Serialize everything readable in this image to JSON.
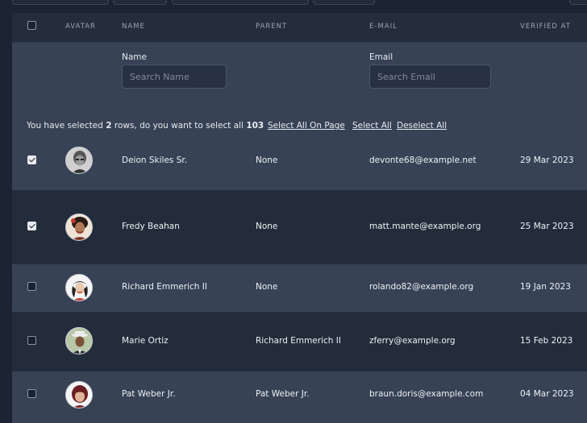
{
  "columns": {
    "avatar": "AVATAR",
    "name": "NAME",
    "parent": "PARENT",
    "email": "E-MAIL",
    "verified_at": "VERIFIED AT"
  },
  "filters": {
    "name_label": "Name",
    "name_placeholder": "Search Name",
    "email_label": "Email",
    "email_placeholder": "Search Email"
  },
  "selection": {
    "prefix": "You have selected ",
    "count": "2",
    "middle": " rows, do you want to select all ",
    "total": "103",
    "select_all_on_page": "Select All On Page",
    "select_all": "Select All",
    "deselect_all": "Deselect All"
  },
  "rows": [
    {
      "checked": true,
      "name": "Deion Skiles Sr.",
      "parent": "None",
      "email": "devonte68@example.net",
      "verified": "29 Mar 2023"
    },
    {
      "checked": true,
      "name": "Fredy Beahan",
      "parent": "None",
      "email": "matt.mante@example.org",
      "verified": "25 Mar 2023"
    },
    {
      "checked": false,
      "name": "Richard Emmerich II",
      "parent": "None",
      "email": "rolando82@example.org",
      "verified": "19 Jan 2023"
    },
    {
      "checked": false,
      "name": "Marie Ortiz",
      "parent": "Richard Emmerich II",
      "email": "zferry@example.org",
      "verified": "15 Feb 2023"
    },
    {
      "checked": false,
      "name": "Pat Weber Jr.",
      "parent": "Pat Weber Jr.",
      "email": "braun.doris@example.com",
      "verified": "04 Mar 2023"
    }
  ],
  "colors": {
    "background": "#1c2433",
    "header": "#242d3c",
    "filter_band": "#374255",
    "row_light": "#374255",
    "row_dark": "#232c3b",
    "text": "#e8ebf0",
    "muted": "#9aa3b4"
  }
}
